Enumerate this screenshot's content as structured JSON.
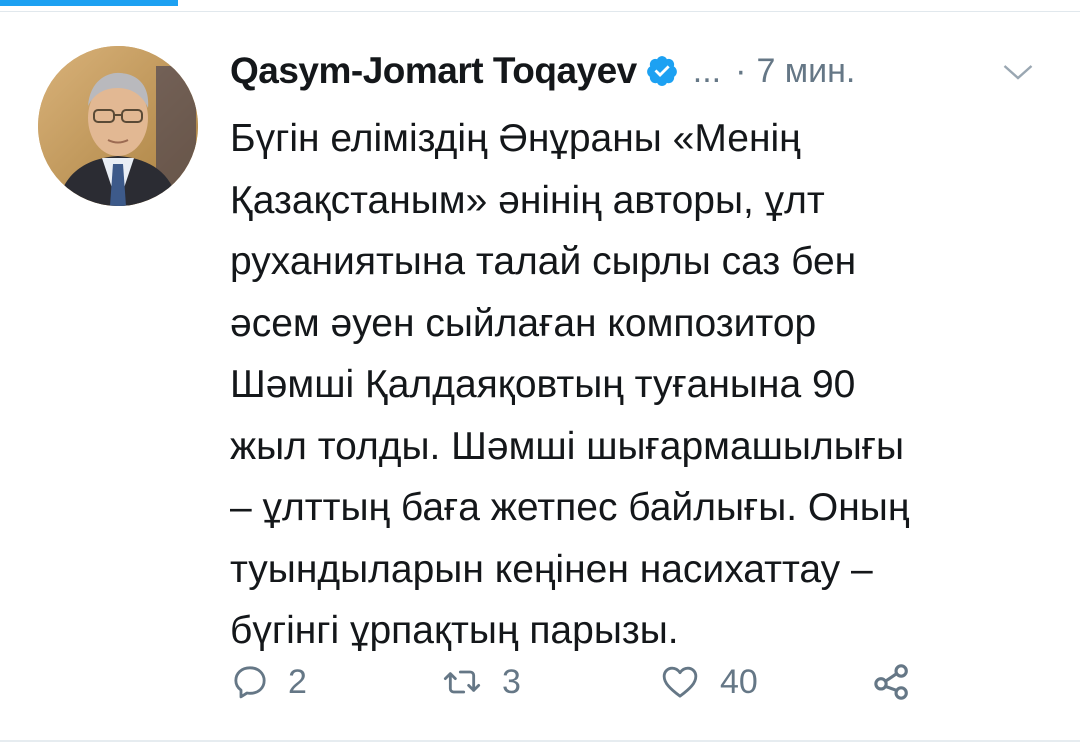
{
  "colors": {
    "accent": "#1da1f2",
    "text_primary": "#14171a",
    "text_secondary": "#657786",
    "verified_badge": "#1da1f2"
  },
  "tweet": {
    "author": {
      "display_name": "Qasym-Jomart Toqayev",
      "verified": true,
      "handle": "...",
      "avatar_icon": "profile-photo"
    },
    "separator": "·",
    "timestamp": "7 мин.",
    "text": "Бүгін еліміздің Әнұраны «Менің\nҚазақстаным» әнінің авторы, ұлт\nруханиятына талай сырлы саз бен\nәсем әуен сыйлаған композитор\nШәмші Қалдаяқовтың туғанына 90\nжыл толды. Шәмші шығармашылығы\n– ұлттың баға жетпес байлығы. Оның\nтуындыларын кеңінен насихаттау –\nбүгінгі ұрпақтың парызы.",
    "actions": {
      "reply": {
        "icon": "reply-icon",
        "count": "2"
      },
      "retweet": {
        "icon": "retweet-icon",
        "count": "3"
      },
      "like": {
        "icon": "heart-icon",
        "count": "40"
      },
      "share": {
        "icon": "share-icon"
      }
    }
  }
}
